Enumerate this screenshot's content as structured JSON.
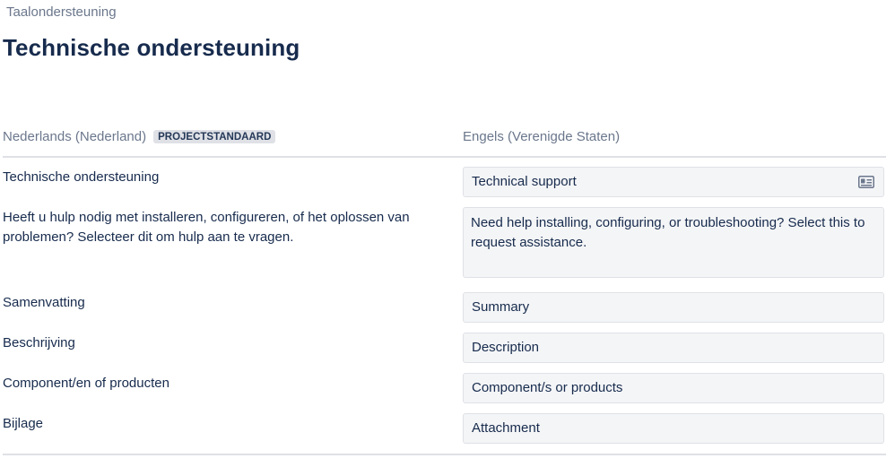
{
  "breadcrumb": "Taalondersteuning",
  "page_title": "Technische ondersteuning",
  "columns": {
    "source_language": "Nederlands (Nederland)",
    "source_badge": "PROJECTSTANDAARD",
    "target_language": "Engels (Verenigde Staten)"
  },
  "rows": [
    {
      "source": "Technische ondersteuning",
      "translation": "Technical support",
      "icon": "id-card-icon"
    },
    {
      "source": "Heeft u hulp nodig met installeren, configureren, of het oplossen van problemen? Selecteer dit om hulp aan te vragen.",
      "translation": "Need help installing, configuring, or troubleshooting? Select this to request assistance."
    },
    {
      "source": "Samenvatting",
      "translation": "Summary"
    },
    {
      "source": "Beschrijving",
      "translation": "Description"
    },
    {
      "source": "Component/en of producten",
      "translation": "Component/s or products"
    },
    {
      "source": "Bijlage",
      "translation": "Attachment"
    }
  ],
  "colors": {
    "text_primary": "#172b4d",
    "text_subtle": "#6b778c",
    "field_background": "#f4f5f7",
    "field_border": "#dfe1e6",
    "badge_background": "#dfe1e6"
  }
}
